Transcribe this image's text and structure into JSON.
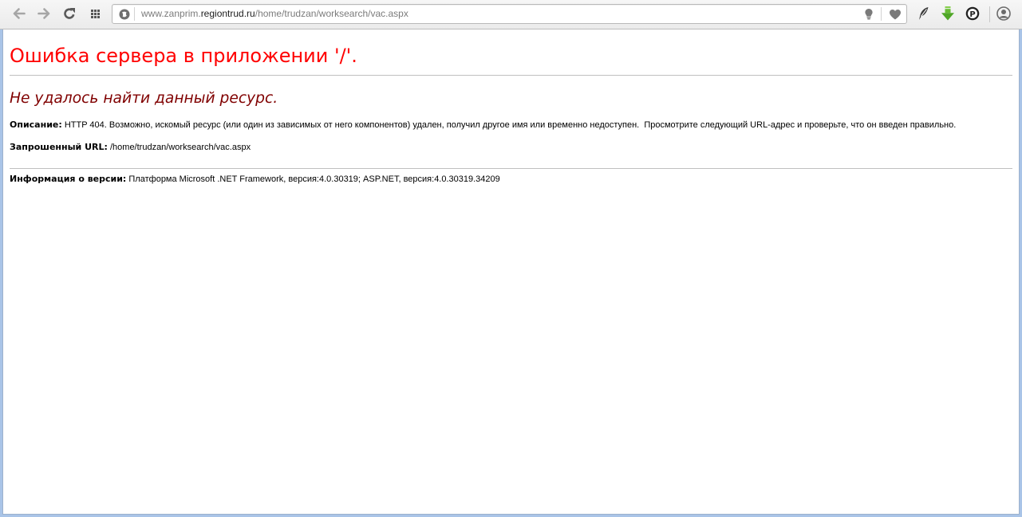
{
  "browser": {
    "toolbar": {
      "back_icon": "back-arrow-icon",
      "forward_icon": "forward-arrow-icon",
      "reload_icon": "reload-icon",
      "speed_dial_icon": "grid-icon"
    },
    "address_bar": {
      "site_info_icon": "site-info-icon",
      "url_subdomain": "www.zanprim.",
      "url_host": "regiontrud.ru",
      "url_path": "/home/trudzan/worksearch/vac.aspx",
      "tips_icon": "lightbulb-icon",
      "stash_icon": "heart-icon"
    },
    "extensions": [
      {
        "icon": "quill-extension-icon"
      },
      {
        "icon": "download-arrow-icon",
        "color": "#5bb52c"
      },
      {
        "icon": "p-logo-extension-icon",
        "logo_letter": "P"
      }
    ],
    "account_icon": "user-account-icon"
  },
  "page": {
    "title": "Ошибка сервера в приложении '/'.",
    "subtitle": "Не удалось найти данный ресурс.",
    "description": {
      "label": "Описание:",
      "text": "HTTP 404. Возможно, искомый ресурс (или один из зависимых от него компонентов) удален, получил другое имя или временно недоступен.  Просмотрите следующий URL-адрес и проверьте, что он введен правильно."
    },
    "requested_url": {
      "label": "Запрошенный URL:",
      "value": "/home/trudzan/worksearch/vac.aspx"
    },
    "version_info": {
      "label": "Информация о версии:",
      "text": "Платформа Microsoft .NET Framework, версия:4.0.30319; ASP.NET, версия:4.0.30319.34209"
    }
  },
  "colors": {
    "title": "#ff0000",
    "subtitle": "#800000",
    "divider": "#c0c0c0",
    "window_frame": "#a9c4e7",
    "url_dim": "#7b7b7b",
    "url_host": "#1c1c1c"
  }
}
